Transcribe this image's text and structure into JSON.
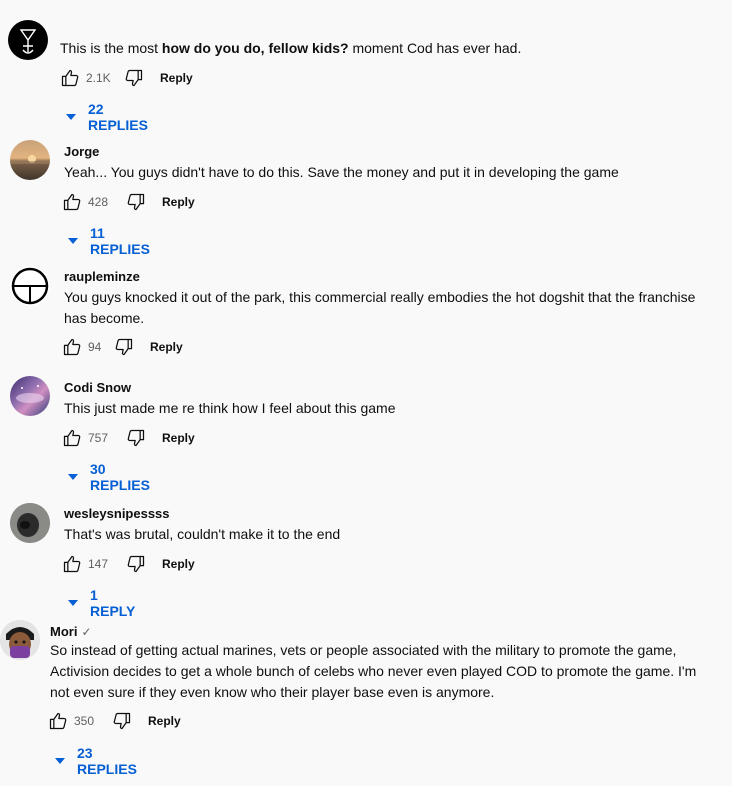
{
  "comments": [
    {
      "author": "",
      "text_pre": "This is the most ",
      "text_bold": "how do you do, fellow kids?",
      "text_post": " moment Cod has ever had.",
      "likes": "2.1K",
      "reply_label": "Reply",
      "replies_label": "22 REPLIES"
    },
    {
      "author": "Jorge",
      "text": "Yeah... You guys didn't have to do this. Save the money and put it in developing the game",
      "likes": "428",
      "reply_label": "Reply",
      "replies_label": "11 REPLIES"
    },
    {
      "author": "raupleminze",
      "text": "You guys knocked it out of the park, this commercial really embodies the hot dogshit that the franchise has become.",
      "likes": "94",
      "reply_label": "Reply"
    },
    {
      "author": "Codi Snow",
      "text": "This just made me re think how I feel about this game",
      "likes": "757",
      "reply_label": "Reply",
      "replies_label": "30 REPLIES"
    },
    {
      "author": "wesleysnipessss",
      "text": "That's was brutal, couldn't make it to the end",
      "likes": "147",
      "reply_label": "Reply",
      "replies_label": "1 REPLY"
    },
    {
      "author": "Mori",
      "verified": "✓",
      "text": "So instead of getting actual marines, vets or people associated with the military to promote the game, Activision decides to get a whole bunch of celebs who never even played COD to promote the game. I'm not even sure if they even know who their player base even is anymore.",
      "likes": "350",
      "reply_label": "Reply",
      "replies_label": "23 REPLIES"
    }
  ],
  "colors": {
    "link": "#065fd4",
    "meta": "#606060",
    "background": "#f9f9f9"
  }
}
